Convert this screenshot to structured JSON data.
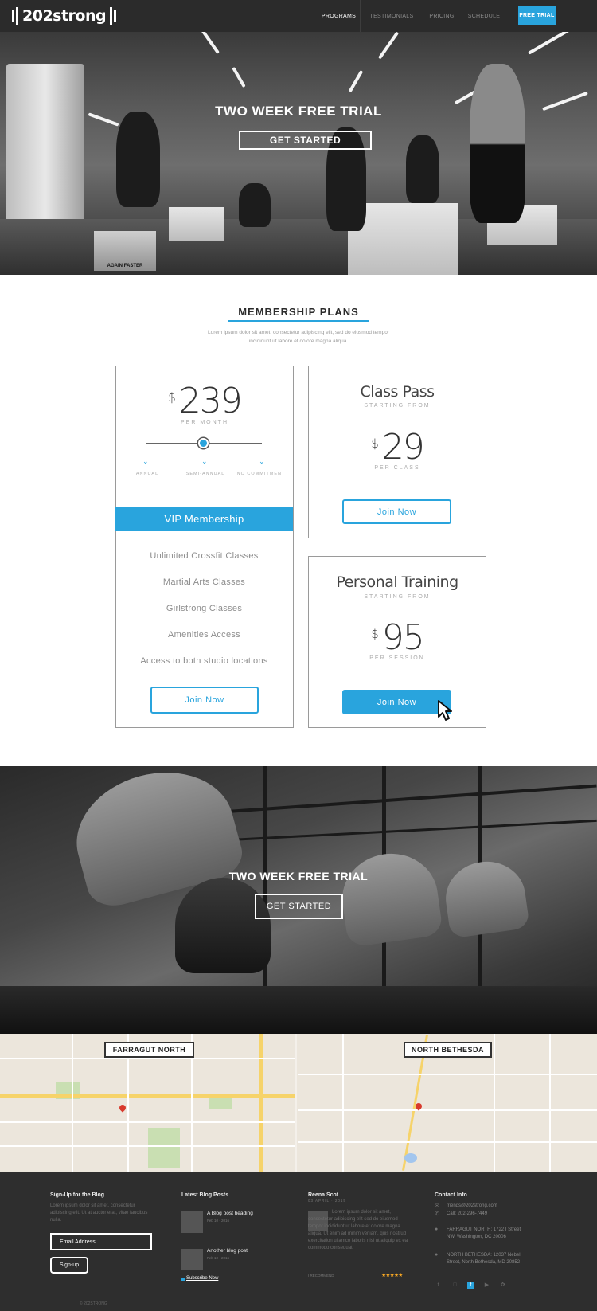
{
  "nav": {
    "logo": "202strong",
    "links": [
      "Programs",
      "Testimonials",
      "Pricing",
      "Schedule"
    ],
    "cta": "Free Trial"
  },
  "hero": {
    "title": "TWO WEEK FREE TRIAL",
    "button": "GET STARTED",
    "box_text": "AGAIN FASTER"
  },
  "membership": {
    "title": "MEMBERSHIP PLANS",
    "subtitle": "Lorem ipsum dolor sit amet, consectetur adipiscing elit, sed do eiusmod tempor incididunt ut labore et dolore magna aliqua.",
    "vip": {
      "currency": "$",
      "price": "239",
      "period": "PER MONTH",
      "options": [
        "ANNUAL",
        "SEMI-ANNUAL",
        "NO COMMITMENT"
      ],
      "band": "VIP Membership",
      "features": [
        "Unlimited Crossfit Classes",
        "Martial Arts Classes",
        "Girlstrong Classes",
        "Amenities Access",
        "Access to both studio locations"
      ],
      "button": "Join Now"
    },
    "classpass": {
      "title": "Class Pass",
      "starting": "STARTING FROM",
      "currency": "$",
      "price": "29",
      "period": "PER CLASS",
      "button": "Join Now"
    },
    "personal": {
      "title": "Personal Training",
      "starting": "STARTING FROM",
      "currency": "$",
      "price": "95",
      "period": "PER SESSION",
      "button": "Join Now"
    }
  },
  "hero2": {
    "title": "TWO WEEK FREE TRIAL",
    "button": "GET STARTED"
  },
  "map": {
    "left_label": "FARRAGUT NORTH",
    "right_label": "NORTH BETHESDA"
  },
  "footer": {
    "signup": {
      "heading": "Sign-Up for the Blog",
      "text": "Lorem ipsum dolor sit amet, consectetur adipiscing elit. Ut at auctor erat, vitae faucibus nulla.",
      "email_placeholder": "Email Address",
      "button": "Sign-up"
    },
    "blog": {
      "heading": "Latest Blog Posts",
      "posts": [
        {
          "title": "A Blog post heading",
          "date": "Feb 10 · 2016"
        },
        {
          "title": "Another blog post",
          "date": "Feb 10 · 2016"
        }
      ],
      "subscribe": "Subscribe Now"
    },
    "testimonial": {
      "name": "Reena Scot",
      "date": "03 APRIL · 2015",
      "text": "Lorem ipsum dolor sit amet, consectetur adipiscing elit sed do eiusmod tempor incididunt ut labore et dolore magna aliqua. Ut enim ad minim veniam, quis nostrud exercitation ullamco laboris nisi ut aliquip ex ea commodo consequat.",
      "tag": "I RECOMMEND",
      "stars": "★★★★★"
    },
    "contact": {
      "heading": "Contact Info",
      "email": "friends@202strong.com",
      "phone": "Call: 202-296-7449",
      "addr1": "FARRAGUT NORTH: 1722 I Street NW, Washington, DC 20006",
      "addr2": "NORTH BETHESDA: 12037 Nebel Street, North Bethesda, MD 20852"
    },
    "copyright": "© 202STRONG"
  },
  "colors": {
    "accent": "#29a4dd",
    "nav_bg": "#2b2b2b",
    "footer_bg": "#2e2e2e"
  }
}
